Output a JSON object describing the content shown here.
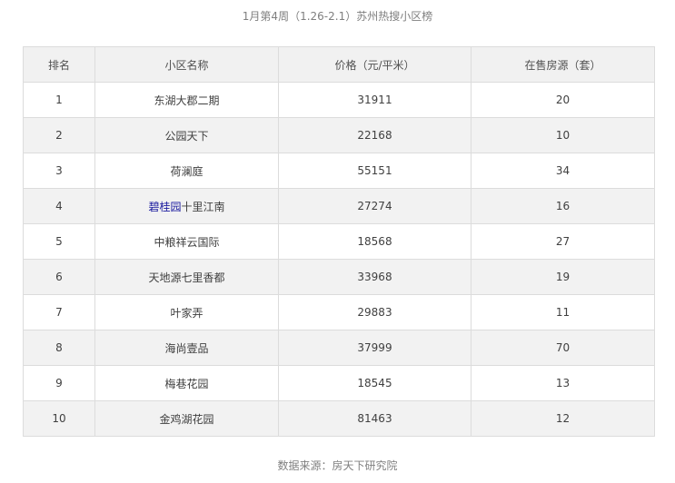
{
  "caption": "1月第4周（1.26-2.1）苏州热搜小区榜",
  "table": {
    "headers": [
      "排名",
      "小区名称",
      "价格（元/平米）",
      "在售房源（套）"
    ],
    "rows": [
      {
        "rank": "1",
        "name": "东湖大郡二期",
        "price": "31911",
        "listings": "20"
      },
      {
        "rank": "2",
        "name": "公园天下",
        "price": "22168",
        "listings": "10"
      },
      {
        "rank": "3",
        "name": "荷澜庭",
        "price": "55151",
        "listings": "34"
      },
      {
        "rank": "4",
        "name_link": "碧桂园",
        "name_rest": "十里江南",
        "price": "27274",
        "listings": "16"
      },
      {
        "rank": "5",
        "name": "中粮祥云国际",
        "price": "18568",
        "listings": "27"
      },
      {
        "rank": "6",
        "name": "天地源七里香都",
        "price": "33968",
        "listings": "19"
      },
      {
        "rank": "7",
        "name": "叶家弄",
        "price": "29883",
        "listings": "11"
      },
      {
        "rank": "8",
        "name": "海尚壹品",
        "price": "37999",
        "listings": "70"
      },
      {
        "rank": "9",
        "name": "梅巷花园",
        "price": "18545",
        "listings": "13"
      },
      {
        "rank": "10",
        "name": "金鸡湖花园",
        "price": "81463",
        "listings": "12"
      }
    ]
  },
  "footer": "数据来源：房天下研究院",
  "colors": {
    "link": "#1a1a9e",
    "header_bg": "#f1f1f1",
    "stripe_bg": "#f2f2f2",
    "border": "#dcdcdc"
  }
}
